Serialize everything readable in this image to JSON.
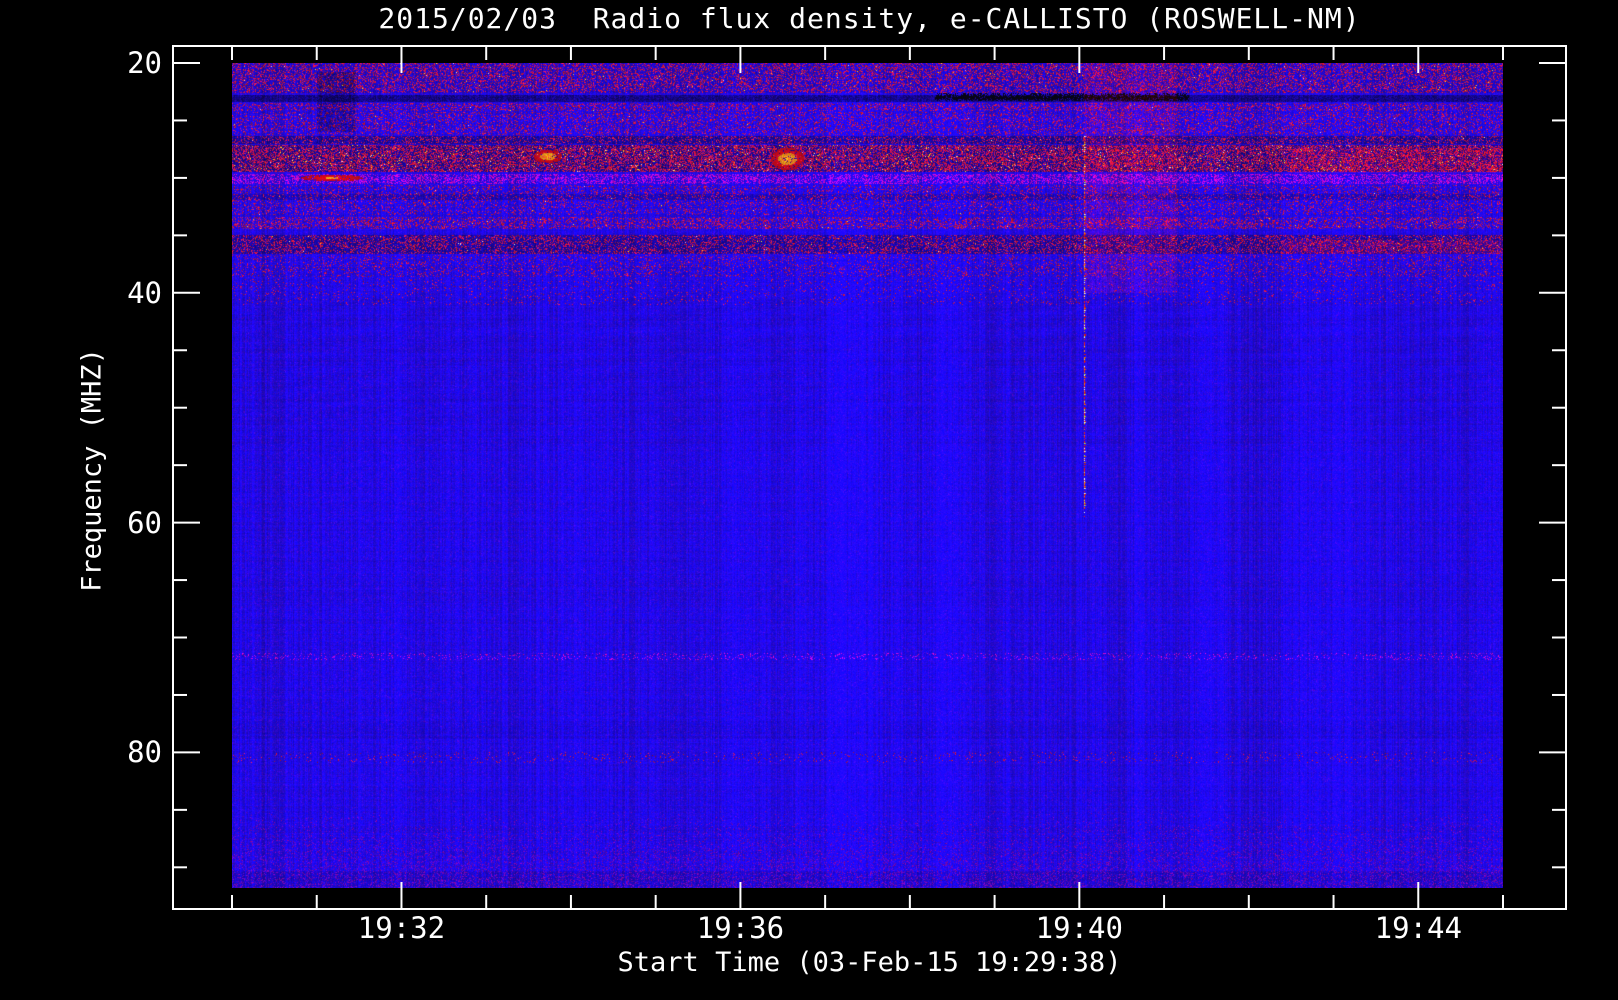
{
  "colors": {
    "background": "#000000",
    "frame": "#ffffff",
    "text": "#ffffff",
    "base_blue": "#1a12e8",
    "rfi_red": "#d8281e",
    "hot_yellow": "#ffd24a",
    "black_band": "#05050a"
  },
  "chart_data": {
    "type": "heatmap",
    "subtype": "radio-spectrogram",
    "title": "2015/02/03  Radio flux density, e-CALLISTO (ROSWELL-NM)",
    "xlabel": "Start Time (03-Feb-15 19:29:38)",
    "ylabel": "Frequency (MHZ)",
    "x_range_time": [
      "19:30",
      "19:45"
    ],
    "x_span_minutes": 15,
    "x_minor_tick_every_min": 1,
    "x_ticks": [
      {
        "label": "19:32",
        "t_min": 2
      },
      {
        "label": "19:36",
        "t_min": 6
      },
      {
        "label": "19:40",
        "t_min": 10
      },
      {
        "label": "19:44",
        "t_min": 14
      }
    ],
    "y_range_mhz": [
      20,
      91.8
    ],
    "y_minor_tick_every_mhz": 5,
    "y_ticks": [
      {
        "label": "20",
        "f": 20
      },
      {
        "label": "40",
        "f": 40
      },
      {
        "label": "60",
        "f": 60
      },
      {
        "label": "80",
        "f": 80
      }
    ],
    "grid": false,
    "legend": "none",
    "background_level": "uniform blue quiet solar continuum below 40 MHz",
    "bands": [
      {
        "f_low": 20.0,
        "f_high": 22.6,
        "type": "rfi_speckle",
        "intensity": 0.33,
        "hot": 0.012
      },
      {
        "f_low": 20.0,
        "f_high": 22.6,
        "type": "darken",
        "intensity": 0.18
      },
      {
        "f_low": 22.7,
        "f_high": 23.35,
        "type": "darken",
        "intensity": 0.6
      },
      {
        "f_low": 23.4,
        "f_high": 24.1,
        "type": "rfi_speckle",
        "intensity": 0.3,
        "hot": 0.004
      },
      {
        "f_low": 24.2,
        "f_high": 26.2,
        "type": "rfi_speckle",
        "intensity": 0.22,
        "hot": 0.003
      },
      {
        "f_low": 26.3,
        "f_high": 27.0,
        "type": "darken",
        "intensity": 0.45
      },
      {
        "f_low": 26.3,
        "f_high": 27.0,
        "type": "rfi_speckle",
        "intensity": 0.25,
        "hot": 0.01
      },
      {
        "f_low": 27.1,
        "f_high": 29.4,
        "type": "darken",
        "intensity": 0.5
      },
      {
        "f_low": 27.1,
        "f_high": 29.4,
        "type": "rfi_speckle",
        "intensity": 0.5,
        "hot": 0.05
      },
      {
        "f_low": 29.6,
        "f_high": 30.5,
        "type": "red_band",
        "intensity": 0.45
      },
      {
        "f_low": 30.6,
        "f_high": 33.2,
        "type": "rfi_speckle",
        "intensity": 0.18,
        "hot": 0.004
      },
      {
        "f_low": 31.4,
        "f_high": 31.9,
        "type": "darken",
        "intensity": 0.3
      },
      {
        "f_low": 33.4,
        "f_high": 34.4,
        "type": "rfi_speckle",
        "intensity": 0.32,
        "hot": 0.01
      },
      {
        "f_low": 34.9,
        "f_high": 36.6,
        "type": "darken",
        "intensity": 0.42
      },
      {
        "f_low": 34.9,
        "f_high": 36.6,
        "type": "rfi_speckle",
        "intensity": 0.3,
        "hot": 0.008
      },
      {
        "f_low": 36.7,
        "f_high": 38.6,
        "type": "rfi_speckle",
        "intensity": 0.14,
        "hot": 0.0
      },
      {
        "f_low": 38.7,
        "f_high": 41.0,
        "type": "rfi_speckle",
        "intensity": 0.06,
        "hot": 0.0
      },
      {
        "f_low": 71.3,
        "f_high": 71.9,
        "type": "red_band",
        "intensity": 0.12
      },
      {
        "f_low": 77.2,
        "f_high": 78.8,
        "type": "darken",
        "intensity": 0.07
      },
      {
        "f_low": 79.9,
        "f_high": 80.9,
        "type": "rfi_speckle",
        "intensity": 0.05,
        "hot": 0.0
      },
      {
        "f_low": 85.0,
        "f_high": 91.8,
        "type": "purple_noise",
        "intensity": 0.25
      },
      {
        "f_low": 90.3,
        "f_high": 91.8,
        "type": "darken",
        "intensity": 0.18
      }
    ],
    "patches": [
      {
        "t_start": 8.3,
        "t_end": 11.3,
        "f_low": 22.6,
        "f_high": 23.35,
        "type": "black_streak",
        "intensity": 0.85
      },
      {
        "t_start": 1.0,
        "t_end": 1.45,
        "f_low": 20.8,
        "f_high": 26.0,
        "type": "dark_patch",
        "intensity": 0.45
      },
      {
        "t_start": 0.8,
        "t_end": 1.55,
        "f_low": 29.7,
        "f_high": 30.3,
        "type": "hot_red_blob",
        "intensity": 0.9
      },
      {
        "t_start": 3.55,
        "t_end": 3.9,
        "f_low": 27.5,
        "f_high": 28.7,
        "type": "hot_spot",
        "intensity": 0.9
      },
      {
        "t_start": 6.35,
        "t_end": 6.75,
        "f_low": 27.3,
        "f_high": 29.3,
        "type": "hot_spot",
        "intensity": 0.95
      },
      {
        "t_start": 10.06,
        "t_end": 11.15,
        "f_low": 20.0,
        "f_high": 40.0,
        "type": "red_wash",
        "intensity": 0.35
      },
      {
        "t_start": 12.5,
        "t_end": 15.0,
        "f_low": 27.4,
        "f_high": 29.6,
        "type": "red_wash",
        "intensity": 0.4
      },
      {
        "t_start": 12.4,
        "t_end": 15.0,
        "f_low": 35.4,
        "f_high": 36.6,
        "type": "red_wash",
        "intensity": 0.45
      }
    ],
    "burst": {
      "time_min": 10.05,
      "f_low": 26.2,
      "f_high": 59.5,
      "description": "narrow dashed vertical streak (red/white/yellow) just after 19:40"
    }
  }
}
